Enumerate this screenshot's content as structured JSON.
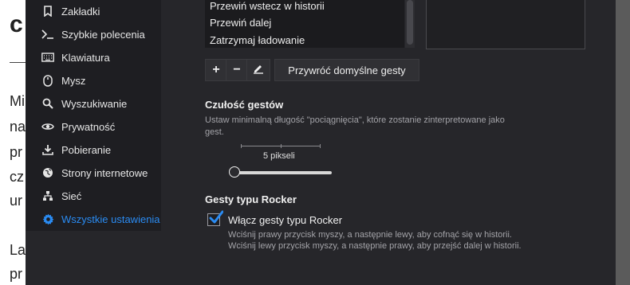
{
  "background_page": {
    "heading": "c",
    "lines": [
      "Mi",
      "na",
      "pr",
      "cz",
      "ur",
      "La",
      "pr"
    ]
  },
  "sidebar": {
    "items": [
      {
        "label": "Zakładki",
        "icon": "bookmark-icon"
      },
      {
        "label": "Szybkie polecenia",
        "icon": "command-prompt-icon"
      },
      {
        "label": "Klawiatura",
        "icon": "keyboard-icon"
      },
      {
        "label": "Mysz",
        "icon": "mouse-icon"
      },
      {
        "label": "Wyszukiwanie",
        "icon": "search-icon"
      },
      {
        "label": "Prywatność",
        "icon": "eye-icon"
      },
      {
        "label": "Pobieranie",
        "icon": "download-icon"
      },
      {
        "label": "Strony internetowe",
        "icon": "globe-icon"
      },
      {
        "label": "Sieć",
        "icon": "network-icon"
      },
      {
        "label": "Wszystkie ustawienia",
        "icon": "gear-icon",
        "active": true
      }
    ],
    "active_color": "#2a8bf2"
  },
  "gestures": {
    "items": [
      "Przewiń wstecz w historii",
      "Przewiń dalej",
      "Zatrzymaj ładowanie"
    ],
    "toolbar": {
      "add_label": "+",
      "remove_label": "−",
      "edit_icon": "pencil-icon",
      "restore_label": "Przywróć domyślne gesty"
    }
  },
  "sensitivity": {
    "title": "Czułość gestów",
    "description": "Ustaw minimalną długość \"pociągnięcia\", które zostanie zinterpretowane jako gest.",
    "value_label": "5 pikseli",
    "slider_fraction": 0.0
  },
  "rocker": {
    "title": "Gesty typu Rocker",
    "checkbox_label": "Włącz gesty typu Rocker",
    "checked": true,
    "check_color": "#2a8bf2",
    "help_lines": [
      "Wciśnij prawy przycisk myszy, a następnie lewy, aby cofnąć się w historii.",
      "Wciśnij lewy przycisk myszy, a następnie prawy, aby przejść dalej w historii."
    ]
  }
}
